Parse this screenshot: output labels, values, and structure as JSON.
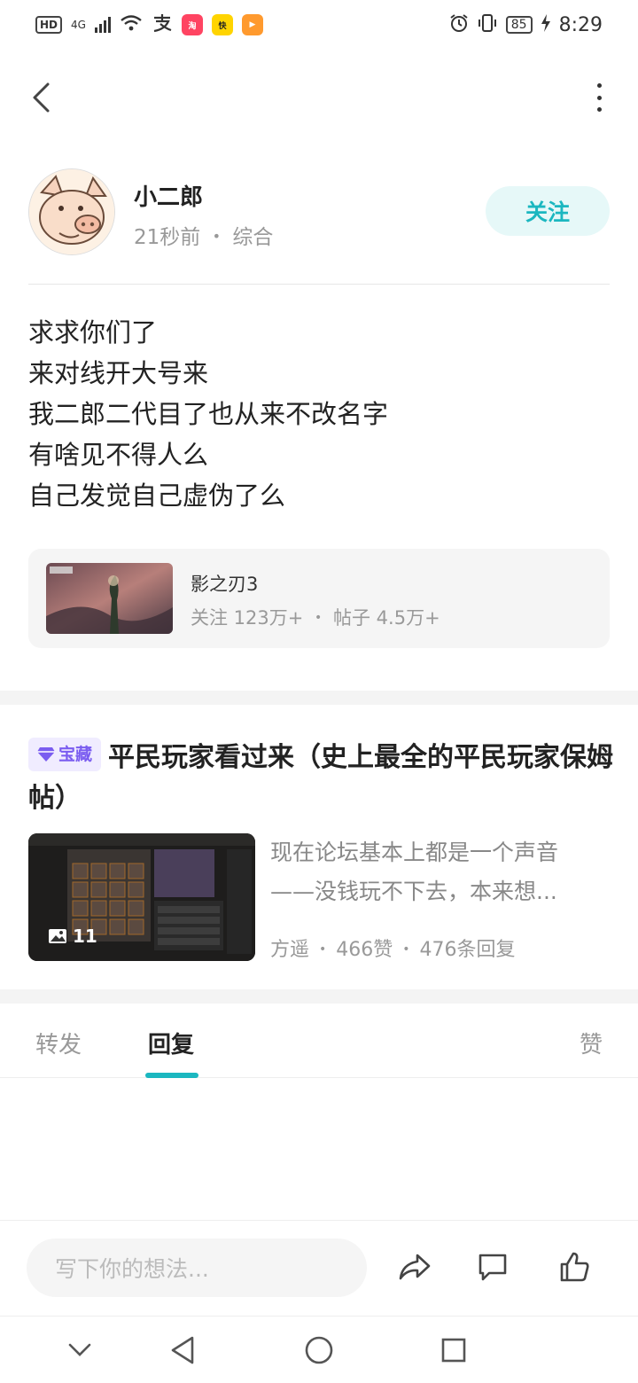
{
  "status_bar": {
    "hd": "HD",
    "network": "4G",
    "app_icons": [
      {
        "name": "alipay-icon",
        "color": "#333333"
      },
      {
        "name": "taobao-app-icon",
        "color": "#ff4462"
      },
      {
        "name": "kuaishou-app-icon",
        "color": "#ffd400"
      },
      {
        "name": "video-app-icon",
        "color": "#ff9a2e"
      }
    ],
    "battery": "85",
    "time": "8:29"
  },
  "author": {
    "name": "小二郎",
    "time": "21秒前",
    "separator": "•",
    "category": "综合",
    "follow_label": "关注"
  },
  "post": {
    "lines": [
      "求求你们了",
      "来对线开大号来",
      "我二郎二代目了也从来不改名字",
      "有啥见不得人么",
      "自己发觉自己虚伪了么"
    ]
  },
  "forum": {
    "name": "影之刃3",
    "followers": "关注 123万+",
    "separator": "•",
    "posts": "帖子 4.5万+"
  },
  "recommended": {
    "badge": "宝藏",
    "title": "平民玩家看过来（史上最全的平民玩家保姆帖）",
    "snippet_line1": "现在论坛基本上都是一个声音",
    "snippet_line2": "——没钱玩不下去，本来想...",
    "image_count": "11",
    "author": "方遥",
    "separator": "•",
    "likes": "466赞",
    "replies": "476条回复"
  },
  "tabs": {
    "repost": "转发",
    "reply": "回复",
    "like": "赞",
    "active": "回复"
  },
  "input": {
    "placeholder": "写下你的想法..."
  },
  "colors": {
    "accent": "#1bb7c0",
    "follow_bg": "#e6f8f8",
    "badge": "#7a5cf0",
    "badge_bg": "#f0ecff"
  }
}
